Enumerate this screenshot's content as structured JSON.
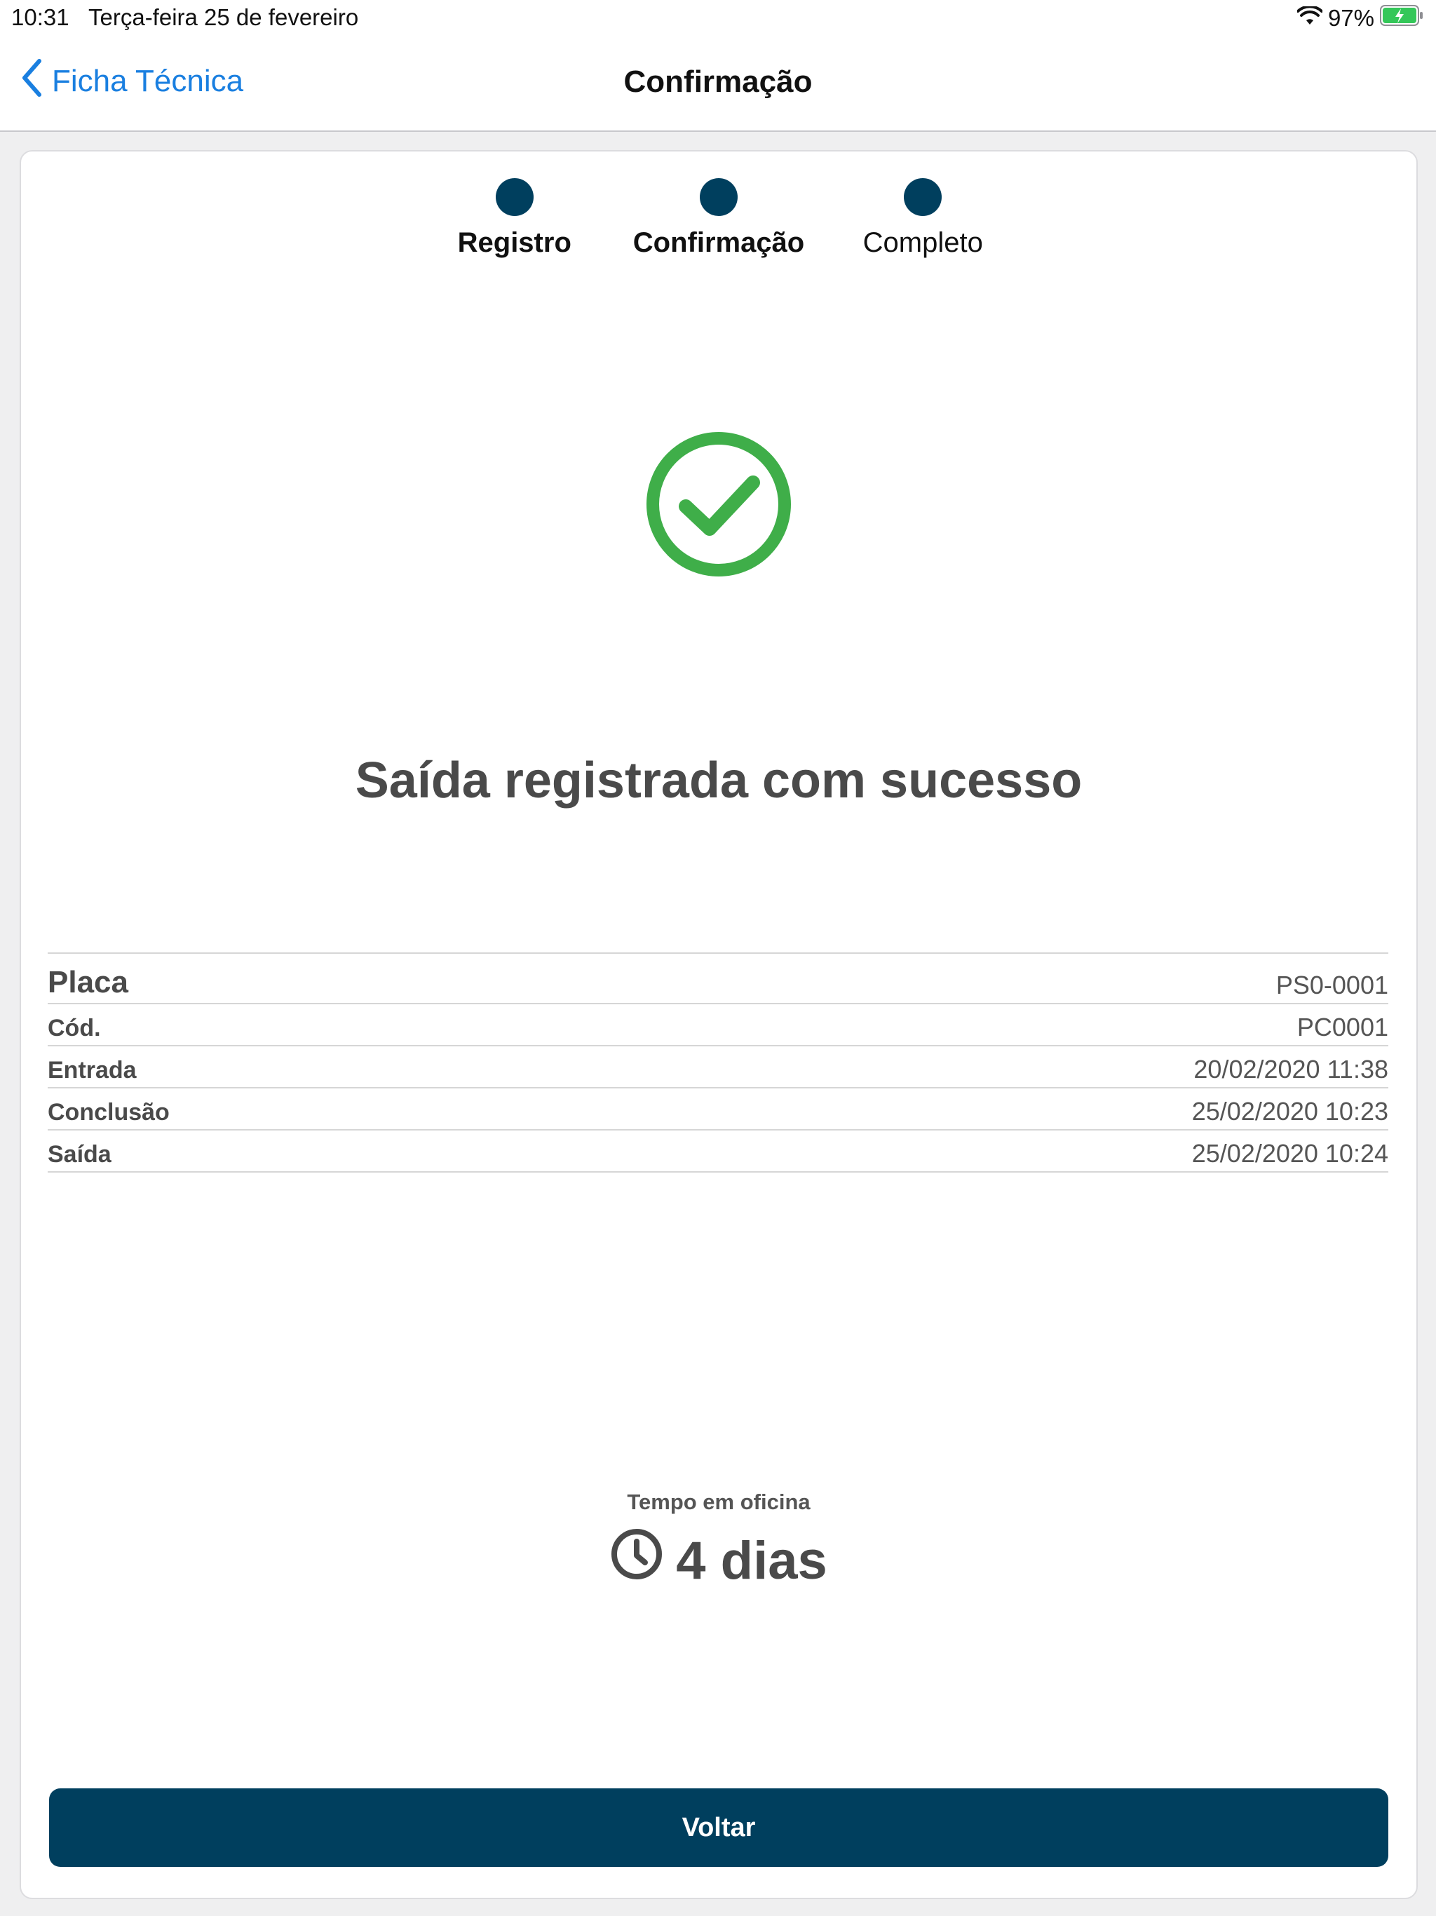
{
  "status_bar": {
    "time": "10:31",
    "date": "Terça-feira 25 de fevereiro",
    "battery": "97%"
  },
  "nav": {
    "back_label": "Ficha Técnica",
    "title": "Confirmação"
  },
  "stepper": {
    "steps": [
      {
        "label": "Registro"
      },
      {
        "label": "Confirmação"
      },
      {
        "label": "Completo"
      }
    ]
  },
  "success": {
    "title": "Saída registrada com sucesso"
  },
  "details": {
    "rows": [
      {
        "label": "Placa",
        "value": "PS0-0001"
      },
      {
        "label": "Cód.",
        "value": "PC0001"
      },
      {
        "label": "Entrada",
        "value": "20/02/2020 11:38"
      },
      {
        "label": "Conclusão",
        "value": "25/02/2020 10:23"
      },
      {
        "label": "Saída",
        "value": "25/02/2020 10:24"
      }
    ]
  },
  "tempo": {
    "label": "Tempo em oficina",
    "value": "4 dias"
  },
  "actions": {
    "voltar_label": "Voltar"
  },
  "colors": {
    "primary": "#003f5e",
    "link": "#1a7fe0",
    "success": "#3fae49"
  },
  "icons": [
    "back-chevron-icon",
    "wifi-icon",
    "battery-charging-icon",
    "checkmark-circle-icon",
    "clock-icon"
  ]
}
